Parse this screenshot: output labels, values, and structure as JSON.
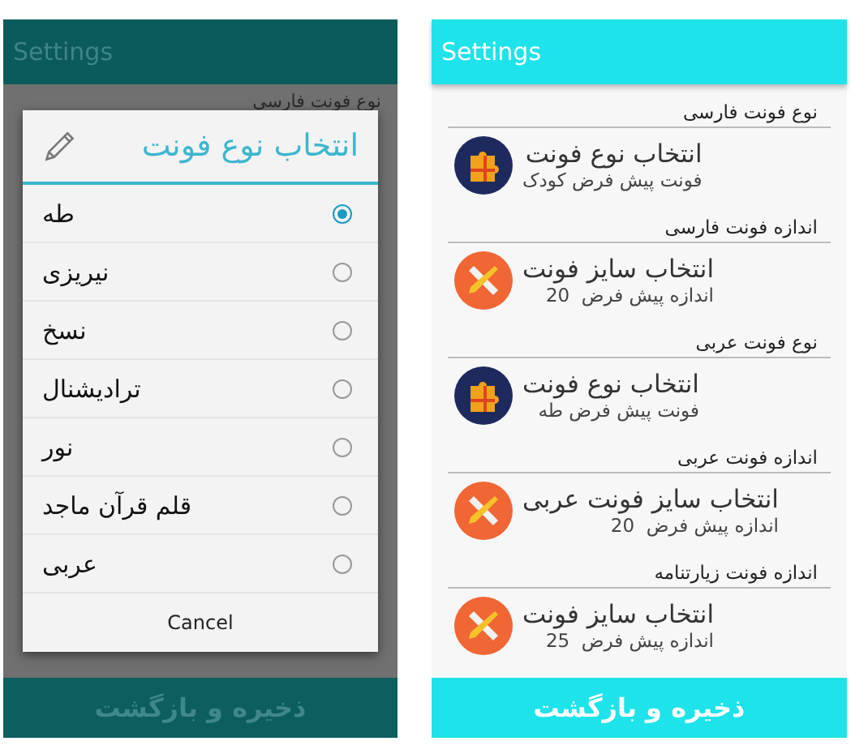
{
  "left_screen": {
    "app_bar_title": "Settings",
    "background_header": "نوع فونت فارسی",
    "dialog": {
      "title": "انتخاب نوع فونت",
      "options": [
        {
          "label": "طه",
          "selected": true
        },
        {
          "label": "نیریزی",
          "selected": false
        },
        {
          "label": "نسخ",
          "selected": false
        },
        {
          "label": "ترادیشنال",
          "selected": false
        },
        {
          "label": "نور",
          "selected": false
        },
        {
          "label": "قلم قرآن ماجد",
          "selected": false
        },
        {
          "label": "عربی",
          "selected": false
        }
      ],
      "cancel": "Cancel"
    },
    "bottom_button": "ذخیره و بازگشت"
  },
  "right_screen": {
    "app_bar_title": "Settings",
    "sections": [
      {
        "header": "نوع فونت فارسی",
        "kind": "type",
        "title": "انتخاب نوع فونت",
        "subtitle": "فونت پیش فرض کودک"
      },
      {
        "header": "اندازه فونت فارسی",
        "kind": "size",
        "title": "انتخاب سایز فونت",
        "subtitle": "اندازه پیش فرض  20"
      },
      {
        "header": "نوع فونت عربی",
        "kind": "type",
        "title": "انتخاب نوع فونت",
        "subtitle": "فونت پیش فرض طه"
      },
      {
        "header": "اندازه فونت عربی",
        "kind": "size",
        "title": "انتخاب سایز فونت عربی",
        "subtitle": "اندازه پیش فرض  20"
      },
      {
        "header": "اندازه فونت زیارتنامه",
        "kind": "size",
        "title": "انتخاب سایز فونت",
        "subtitle": "اندازه پیش فرض  25"
      }
    ],
    "bottom_button": "ذخیره و بازگشت"
  }
}
